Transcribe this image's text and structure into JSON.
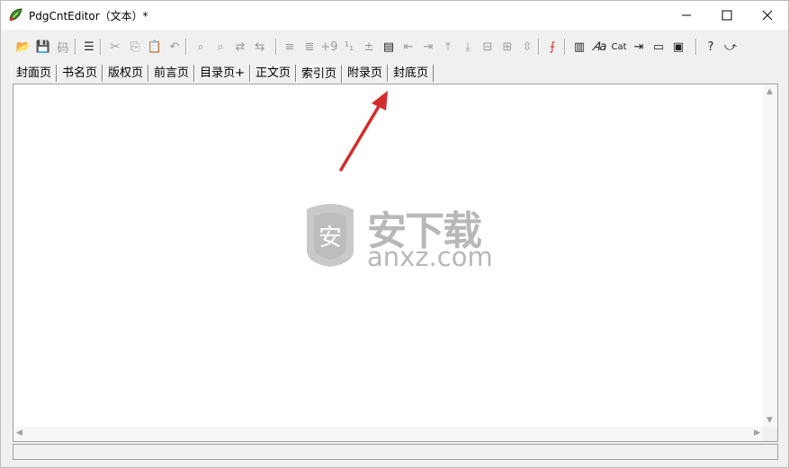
{
  "window": {
    "title": "PdgCntEditor（文本）*",
    "accent_color": "#d42c2c"
  },
  "toolbar": {
    "items": [
      {
        "name": "open-folder-icon",
        "glyph": "📂",
        "enabled": true
      },
      {
        "name": "save-icon",
        "glyph": "💾",
        "enabled": true
      },
      {
        "name": "encoding-icon",
        "glyph": "码",
        "enabled": false
      },
      {
        "name": "outline-icon",
        "glyph": "☰",
        "enabled": true
      },
      {
        "name": "cut-icon",
        "glyph": "✂",
        "enabled": false
      },
      {
        "name": "copy-icon",
        "glyph": "⎘",
        "enabled": false
      },
      {
        "name": "paste-icon",
        "glyph": "📋",
        "enabled": true
      },
      {
        "name": "undo-icon",
        "glyph": "↶",
        "enabled": false
      },
      {
        "name": "find-icon",
        "glyph": "⌕",
        "enabled": false
      },
      {
        "name": "find-next-icon",
        "glyph": "⌕",
        "enabled": false
      },
      {
        "name": "replace-icon",
        "glyph": "⇄",
        "enabled": false
      },
      {
        "name": "replace-all-icon",
        "glyph": "⇆",
        "enabled": false
      },
      {
        "name": "align-left-icon",
        "glyph": "≡",
        "enabled": false
      },
      {
        "name": "align-indent-icon",
        "glyph": "≣",
        "enabled": false
      },
      {
        "name": "page-offset-icon",
        "glyph": "+9",
        "enabled": false
      },
      {
        "name": "page-number-icon",
        "glyph": "¹₁",
        "enabled": false
      },
      {
        "name": "plus-minus-icon",
        "glyph": "±",
        "enabled": false
      },
      {
        "name": "document-icon",
        "glyph": "▤",
        "enabled": true
      },
      {
        "name": "indent-decrease-icon",
        "glyph": "⇤",
        "enabled": false
      },
      {
        "name": "indent-increase-icon",
        "glyph": "⇥",
        "enabled": false
      },
      {
        "name": "move-up-icon",
        "glyph": "⤒",
        "enabled": false
      },
      {
        "name": "move-down-icon",
        "glyph": "⤓",
        "enabled": false
      },
      {
        "name": "collapse-icon",
        "glyph": "⊟",
        "enabled": false
      },
      {
        "name": "expand-icon",
        "glyph": "⊞",
        "enabled": false
      },
      {
        "name": "fit-icon",
        "glyph": "⇳",
        "enabled": false
      },
      {
        "name": "pdf-icon",
        "glyph": "⨍",
        "enabled": true
      },
      {
        "name": "columns-icon",
        "glyph": "▥",
        "enabled": true
      },
      {
        "name": "font-icon",
        "glyph": "𝐴a",
        "enabled": true
      },
      {
        "name": "catalog-icon",
        "glyph": "Cat",
        "enabled": true
      },
      {
        "name": "link-icon",
        "glyph": "⇥",
        "enabled": true
      },
      {
        "name": "windows-icon",
        "glyph": "▭",
        "enabled": true
      },
      {
        "name": "preview-icon",
        "glyph": "▣",
        "enabled": true
      },
      {
        "name": "help-icon",
        "glyph": "?",
        "enabled": true
      },
      {
        "name": "pointer-help-icon",
        "glyph": "⤻",
        "enabled": true
      }
    ]
  },
  "tabs": [
    {
      "label": "封面页"
    },
    {
      "label": "书名页"
    },
    {
      "label": "版权页"
    },
    {
      "label": "前言页"
    },
    {
      "label": "目录页+"
    },
    {
      "label": "正文页"
    },
    {
      "label": "索引页",
      "active": true
    },
    {
      "label": "附录页"
    },
    {
      "label": "封底页"
    }
  ],
  "watermark": {
    "shield_char": "安",
    "title": "安下载",
    "domain": "anxz.com"
  }
}
